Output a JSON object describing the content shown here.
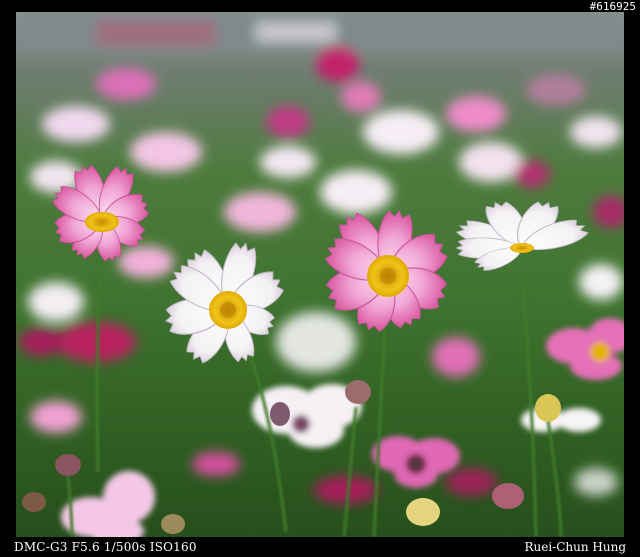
{
  "photo": {
    "id_label": "#616925",
    "exif_text": "DMC-G3 F5.6 1/500s ISO160",
    "credit_text": "Ruei-Chun Hung",
    "subject": "cosmos-flower-field",
    "colors": {
      "background": "#000000",
      "foliage": "#3f7330",
      "petal_white": "#f6f3f6",
      "petal_pink": "#e07ac0",
      "petal_magenta": "#c23a8c",
      "center_yellow": "#e6b400",
      "text": "#ffffff"
    }
  }
}
